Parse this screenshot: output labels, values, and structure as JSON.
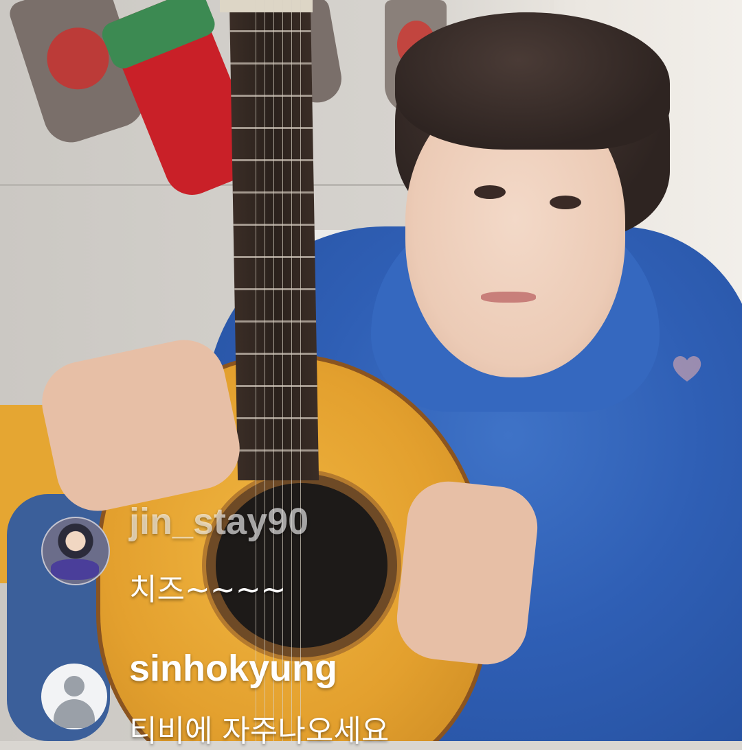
{
  "live_comments": [
    {
      "username": "jin_stay90",
      "message": "치즈~~~~",
      "avatar": "profile-photo"
    },
    {
      "username": "sinhokyung",
      "message": "티비에 자주나오세요",
      "avatar": "default-user-icon"
    }
  ],
  "colors": {
    "username_faded": "#ffffffa0",
    "username": "#ffffff",
    "message": "#ffffff",
    "heart": "#f3b3ad"
  }
}
